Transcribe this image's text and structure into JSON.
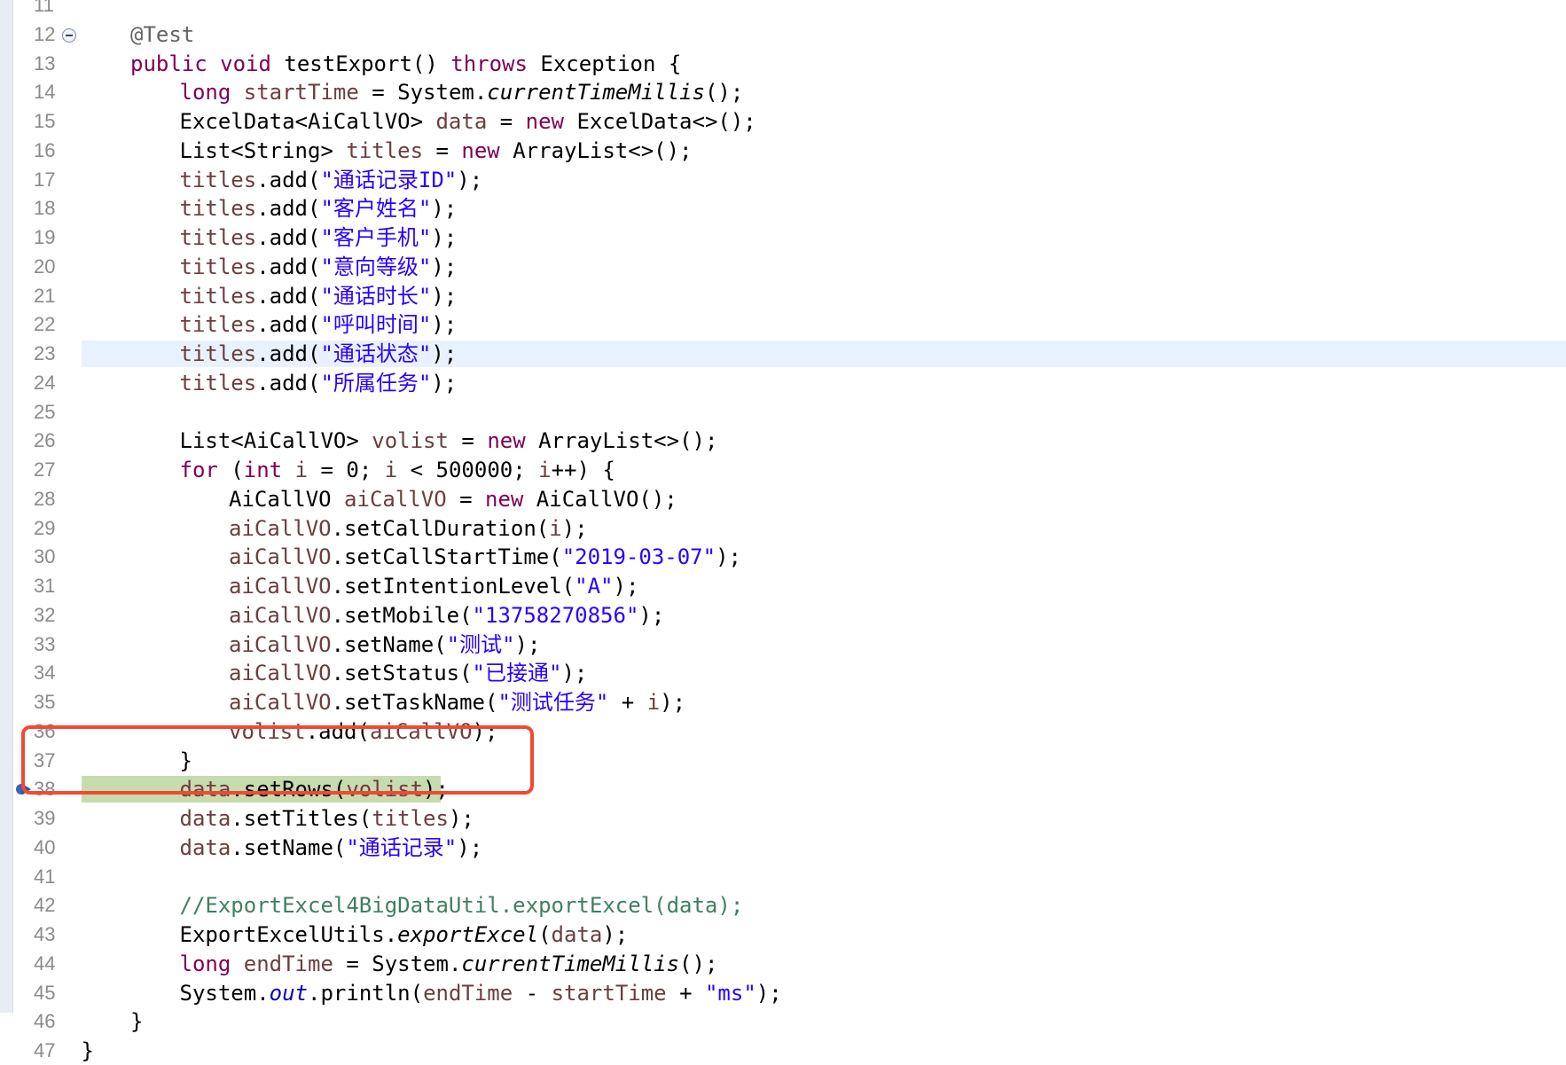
{
  "editor": {
    "lines": [
      {
        "n": "11",
        "tokens": []
      },
      {
        "n": "12",
        "tokens": [
          {
            "c": "ann",
            "t": "@Test"
          }
        ]
      },
      {
        "n": "13",
        "tokens": [
          {
            "c": "kw",
            "t": "public"
          },
          {
            "c": "plain",
            "t": " "
          },
          {
            "c": "kw",
            "t": "void"
          },
          {
            "c": "plain",
            "t": " testExport() "
          },
          {
            "c": "kw",
            "t": "throws"
          },
          {
            "c": "plain",
            "t": " Exception {"
          }
        ]
      },
      {
        "n": "14",
        "tokens": [
          {
            "c": "kw",
            "t": "long"
          },
          {
            "c": "plain",
            "t": " "
          },
          {
            "c": "var",
            "t": "startTime"
          },
          {
            "c": "plain",
            "t": " = System."
          },
          {
            "c": "smc",
            "t": "currentTimeMillis"
          },
          {
            "c": "plain",
            "t": "();"
          }
        ]
      },
      {
        "n": "15",
        "tokens": [
          {
            "c": "plain",
            "t": "ExcelData<AiCallVO> "
          },
          {
            "c": "var",
            "t": "data"
          },
          {
            "c": "plain",
            "t": " = "
          },
          {
            "c": "kw",
            "t": "new"
          },
          {
            "c": "plain",
            "t": " ExcelData<>();"
          }
        ]
      },
      {
        "n": "16",
        "tokens": [
          {
            "c": "plain",
            "t": "List<String> "
          },
          {
            "c": "var",
            "t": "titles"
          },
          {
            "c": "plain",
            "t": " = "
          },
          {
            "c": "kw",
            "t": "new"
          },
          {
            "c": "plain",
            "t": " ArrayList<>();"
          }
        ]
      },
      {
        "n": "17",
        "tokens": [
          {
            "c": "var",
            "t": "titles"
          },
          {
            "c": "plain",
            "t": ".add("
          },
          {
            "c": "str",
            "t": "\"通话记录ID\""
          },
          {
            "c": "plain",
            "t": ");"
          }
        ]
      },
      {
        "n": "18",
        "tokens": [
          {
            "c": "var",
            "t": "titles"
          },
          {
            "c": "plain",
            "t": ".add("
          },
          {
            "c": "str",
            "t": "\"客户姓名\""
          },
          {
            "c": "plain",
            "t": ");"
          }
        ]
      },
      {
        "n": "19",
        "tokens": [
          {
            "c": "var",
            "t": "titles"
          },
          {
            "c": "plain",
            "t": ".add("
          },
          {
            "c": "str",
            "t": "\"客户手机\""
          },
          {
            "c": "plain",
            "t": ");"
          }
        ]
      },
      {
        "n": "20",
        "tokens": [
          {
            "c": "var",
            "t": "titles"
          },
          {
            "c": "plain",
            "t": ".add("
          },
          {
            "c": "str",
            "t": "\"意向等级\""
          },
          {
            "c": "plain",
            "t": ");"
          }
        ]
      },
      {
        "n": "21",
        "tokens": [
          {
            "c": "var",
            "t": "titles"
          },
          {
            "c": "plain",
            "t": ".add("
          },
          {
            "c": "str",
            "t": "\"通话时长\""
          },
          {
            "c": "plain",
            "t": ");"
          }
        ]
      },
      {
        "n": "22",
        "tokens": [
          {
            "c": "var",
            "t": "titles"
          },
          {
            "c": "plain",
            "t": ".add("
          },
          {
            "c": "str",
            "t": "\"呼叫时间\""
          },
          {
            "c": "plain",
            "t": ");"
          }
        ]
      },
      {
        "n": "23",
        "tokens": [
          {
            "c": "var",
            "t": "titles"
          },
          {
            "c": "plain",
            "t": ".add("
          },
          {
            "c": "str",
            "t": "\"通话状态\""
          },
          {
            "c": "plain",
            "t": ");"
          }
        ]
      },
      {
        "n": "24",
        "tokens": [
          {
            "c": "var",
            "t": "titles"
          },
          {
            "c": "plain",
            "t": ".add("
          },
          {
            "c": "str",
            "t": "\"所属任务\""
          },
          {
            "c": "plain",
            "t": ");"
          }
        ]
      },
      {
        "n": "25",
        "tokens": []
      },
      {
        "n": "26",
        "tokens": [
          {
            "c": "plain",
            "t": "List<AiCallVO> "
          },
          {
            "c": "var",
            "t": "volist"
          },
          {
            "c": "plain",
            "t": " = "
          },
          {
            "c": "kw",
            "t": "new"
          },
          {
            "c": "plain",
            "t": " ArrayList<>();"
          }
        ]
      },
      {
        "n": "27",
        "tokens": [
          {
            "c": "kw",
            "t": "for"
          },
          {
            "c": "plain",
            "t": " ("
          },
          {
            "c": "kw",
            "t": "int"
          },
          {
            "c": "plain",
            "t": " "
          },
          {
            "c": "var",
            "t": "i"
          },
          {
            "c": "plain",
            "t": " = 0; "
          },
          {
            "c": "var",
            "t": "i"
          },
          {
            "c": "plain",
            "t": " < 500000; "
          },
          {
            "c": "var",
            "t": "i"
          },
          {
            "c": "plain",
            "t": "++) {"
          }
        ]
      },
      {
        "n": "28",
        "tokens": [
          {
            "c": "plain",
            "t": "AiCallVO "
          },
          {
            "c": "var",
            "t": "aiCallVO"
          },
          {
            "c": "plain",
            "t": " = "
          },
          {
            "c": "kw",
            "t": "new"
          },
          {
            "c": "plain",
            "t": " AiCallVO();"
          }
        ]
      },
      {
        "n": "29",
        "tokens": [
          {
            "c": "var",
            "t": "aiCallVO"
          },
          {
            "c": "plain",
            "t": ".setCallDuration("
          },
          {
            "c": "var",
            "t": "i"
          },
          {
            "c": "plain",
            "t": ");"
          }
        ]
      },
      {
        "n": "30",
        "tokens": [
          {
            "c": "var",
            "t": "aiCallVO"
          },
          {
            "c": "plain",
            "t": ".setCallStartTime("
          },
          {
            "c": "str",
            "t": "\"2019-03-07\""
          },
          {
            "c": "plain",
            "t": ");"
          }
        ]
      },
      {
        "n": "31",
        "tokens": [
          {
            "c": "var",
            "t": "aiCallVO"
          },
          {
            "c": "plain",
            "t": ".setIntentionLevel("
          },
          {
            "c": "str",
            "t": "\"A\""
          },
          {
            "c": "plain",
            "t": ");"
          }
        ]
      },
      {
        "n": "32",
        "tokens": [
          {
            "c": "var",
            "t": "aiCallVO"
          },
          {
            "c": "plain",
            "t": ".setMobile("
          },
          {
            "c": "str",
            "t": "\"13758270856\""
          },
          {
            "c": "plain",
            "t": ");"
          }
        ]
      },
      {
        "n": "33",
        "tokens": [
          {
            "c": "var",
            "t": "aiCallVO"
          },
          {
            "c": "plain",
            "t": ".setName("
          },
          {
            "c": "str",
            "t": "\"测试\""
          },
          {
            "c": "plain",
            "t": ");"
          }
        ]
      },
      {
        "n": "34",
        "tokens": [
          {
            "c": "var",
            "t": "aiCallVO"
          },
          {
            "c": "plain",
            "t": ".setStatus("
          },
          {
            "c": "str",
            "t": "\"已接通\""
          },
          {
            "c": "plain",
            "t": ");"
          }
        ]
      },
      {
        "n": "35",
        "tokens": [
          {
            "c": "var",
            "t": "aiCallVO"
          },
          {
            "c": "plain",
            "t": ".setTaskName("
          },
          {
            "c": "str",
            "t": "\"测试任务\""
          },
          {
            "c": "plain",
            "t": " + "
          },
          {
            "c": "var",
            "t": "i"
          },
          {
            "c": "plain",
            "t": ");"
          }
        ]
      },
      {
        "n": "36",
        "tokens": [
          {
            "c": "var",
            "t": "volist"
          },
          {
            "c": "plain",
            "t": ".add("
          },
          {
            "c": "var",
            "t": "aiCallVO"
          },
          {
            "c": "plain",
            "t": ");"
          }
        ]
      },
      {
        "n": "37",
        "tokens": [
          {
            "c": "plain",
            "t": "}"
          }
        ]
      },
      {
        "n": "38",
        "tokens": [
          {
            "c": "var",
            "t": "data"
          },
          {
            "c": "plain",
            "t": ".setRows("
          },
          {
            "c": "var",
            "t": "volist"
          },
          {
            "c": "plain",
            "t": ");"
          }
        ]
      },
      {
        "n": "39",
        "tokens": [
          {
            "c": "var",
            "t": "data"
          },
          {
            "c": "plain",
            "t": ".setTitles("
          },
          {
            "c": "var",
            "t": "titles"
          },
          {
            "c": "plain",
            "t": ");"
          }
        ]
      },
      {
        "n": "40",
        "tokens": [
          {
            "c": "var",
            "t": "data"
          },
          {
            "c": "plain",
            "t": ".setName("
          },
          {
            "c": "str",
            "t": "\"通话记录\""
          },
          {
            "c": "plain",
            "t": ");"
          }
        ]
      },
      {
        "n": "41",
        "tokens": []
      },
      {
        "n": "42",
        "tokens": [
          {
            "c": "cmt",
            "t": "//ExportExcel4BigDataUtil.exportExcel(data);"
          }
        ]
      },
      {
        "n": "43",
        "tokens": [
          {
            "c": "plain",
            "t": "ExportExcelUtils."
          },
          {
            "c": "smc",
            "t": "exportExcel"
          },
          {
            "c": "plain",
            "t": "("
          },
          {
            "c": "var",
            "t": "data"
          },
          {
            "c": "plain",
            "t": ");"
          }
        ]
      },
      {
        "n": "44",
        "tokens": [
          {
            "c": "kw",
            "t": "long"
          },
          {
            "c": "plain",
            "t": " "
          },
          {
            "c": "var",
            "t": "endTime"
          },
          {
            "c": "plain",
            "t": " = System."
          },
          {
            "c": "smc",
            "t": "currentTimeMillis"
          },
          {
            "c": "plain",
            "t": "();"
          }
        ]
      },
      {
        "n": "45",
        "tokens": [
          {
            "c": "plain",
            "t": "System."
          },
          {
            "c": "fld",
            "t": "out"
          },
          {
            "c": "plain",
            "t": ".println("
          },
          {
            "c": "var",
            "t": "endTime"
          },
          {
            "c": "plain",
            "t": " - "
          },
          {
            "c": "var",
            "t": "startTime"
          },
          {
            "c": "plain",
            "t": " + "
          },
          {
            "c": "str",
            "t": "\"ms\""
          },
          {
            "c": "plain",
            "t": ");"
          }
        ]
      },
      {
        "n": "46",
        "tokens": [
          {
            "c": "plain",
            "t": "}"
          }
        ]
      },
      {
        "n": "47",
        "tokens": [
          {
            "c": "plain",
            "t": "}"
          }
        ]
      }
    ],
    "current_line": "23",
    "debug_line": "38",
    "folded_line": "12",
    "annotated_lines": [
      "37",
      "38",
      "39"
    ]
  },
  "colors": {
    "keyword": "#7f0055",
    "string": "#2a00ff",
    "local_variable": "#6a3e3e",
    "comment": "#3f7f5f",
    "annotation_box": "#f04a32",
    "current_line": "#e8f2fe",
    "debug_line": "#c6dbae"
  },
  "icons": {
    "fold": "fold-minus-icon",
    "breakpoint": "breakpoint-arrow-icon"
  }
}
